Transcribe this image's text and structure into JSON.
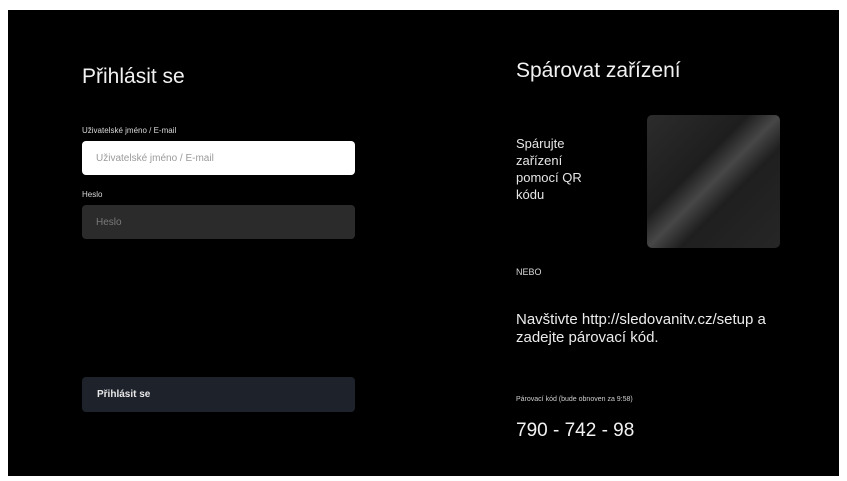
{
  "login": {
    "title": "Přihlásit se",
    "username_label": "Uživatelské jméno / E-mail",
    "username_placeholder": "Uživatelské jméno / E-mail",
    "password_label": "Heslo",
    "password_placeholder": "Heslo",
    "submit_label": "Přihlásit se"
  },
  "pairing": {
    "title": "Spárovat zařízení",
    "qr_text": "Spárujte zařízení pomocí QR kódu",
    "or_text": "NEBO",
    "visit_text": "Navštivte http://sledovanitv.cz/setup a zadejte párovací kód.",
    "code_label": "Párovací kód (bude obnoven za 9:58)",
    "code": "790 - 742 - 98"
  },
  "colors": {
    "background": "#000000",
    "input_active": "#ffffff",
    "input_inactive": "#2b2b2b",
    "button": "#1d222b"
  }
}
